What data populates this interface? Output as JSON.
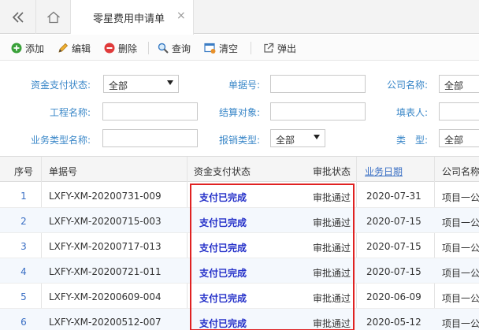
{
  "tabs": {
    "active_title": "零星费用申请单",
    "close_glyph": "×"
  },
  "toolbar": {
    "add": "添加",
    "edit": "编辑",
    "delete": "删除",
    "search": "查询",
    "clear": "清空",
    "popup": "弹出"
  },
  "filters": {
    "pay_status_label": "资金支付状态:",
    "pay_status_value": "全部",
    "doc_no_label": "单据号:",
    "company_label": "公司名称:",
    "company_value": "全部",
    "project_label": "工程名称:",
    "settle_label": "结算对象:",
    "filler_label": "填表人:",
    "biztype_label": "业务类型名称:",
    "reimb_label": "报销类型:",
    "reimb_value": "全部",
    "type_label": "类　型:",
    "type_value": "全部"
  },
  "grid": {
    "columns": [
      "序号",
      "单据号",
      "资金支付状态",
      "审批状态",
      "业务日期",
      "公司名称"
    ],
    "rows": [
      {
        "no": "1",
        "doc": "LXFY-XM-20200731-009",
        "pay": "支付已完成",
        "approve": "审批通过",
        "date": "2020-07-31",
        "company": "项目一公"
      },
      {
        "no": "2",
        "doc": "LXFY-XM-20200715-003",
        "pay": "支付已完成",
        "approve": "审批通过",
        "date": "2020-07-15",
        "company": "项目一公"
      },
      {
        "no": "3",
        "doc": "LXFY-XM-20200717-013",
        "pay": "支付已完成",
        "approve": "审批通过",
        "date": "2020-07-15",
        "company": "项目一公"
      },
      {
        "no": "4",
        "doc": "LXFY-XM-20200721-011",
        "pay": "支付已完成",
        "approve": "审批通过",
        "date": "2020-07-15",
        "company": "项目一公"
      },
      {
        "no": "5",
        "doc": "LXFY-XM-20200609-004",
        "pay": "支付已完成",
        "approve": "审批通过",
        "date": "2020-06-09",
        "company": "项目一公"
      },
      {
        "no": "6",
        "doc": "LXFY-XM-20200512-007",
        "pay": "支付已完成",
        "approve": "审批通过",
        "date": "2020-05-12",
        "company": "项目一公"
      }
    ]
  },
  "colors": {
    "label_blue": "#3a87c8",
    "pay_text": "#2430c9",
    "highlight_red": "#e02222",
    "alt_row": "#f4f8fd"
  }
}
